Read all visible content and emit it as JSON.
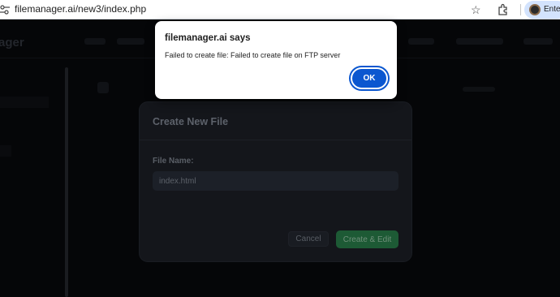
{
  "browser": {
    "url": "filemanager.ai/new3/index.php",
    "profile_label": "Enter",
    "icons": [
      "site-settings-icon",
      "star-icon",
      "extensions-icon",
      "avatar"
    ]
  },
  "app": {
    "brand_partial": "ager"
  },
  "modal": {
    "title": "Create New File",
    "file_name_label": "File Name:",
    "file_name_value": "index.html",
    "cancel_label": "Cancel",
    "create_label": "Create & Edit"
  },
  "alert": {
    "title": "filemanager.ai says",
    "message": "Failed to create file: Failed to create file on FTP server",
    "ok_label": "OK",
    "accent": "#0b57d0"
  }
}
